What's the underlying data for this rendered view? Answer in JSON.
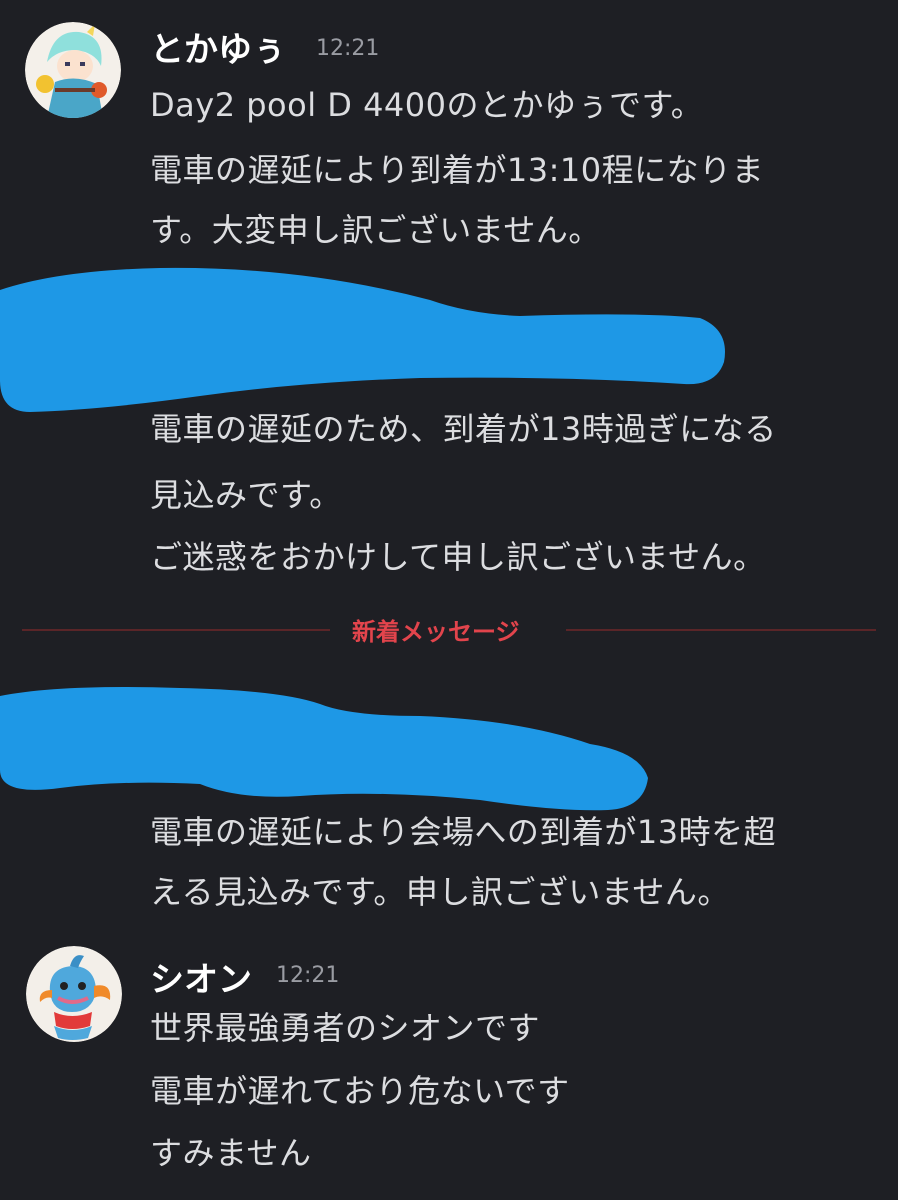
{
  "messages": [
    {
      "username": "とかゆぅ",
      "time": "12:21",
      "lines": [
        "Day2 pool D 4400のとかゆぅです。",
        "電車の遅延により到着が13:10程になりま",
        "す。大変申し訳ございません。"
      ]
    },
    {
      "lines": [
        "電車の遅延のため、到着が13時過ぎになる",
        "見込みです。",
        "ご迷惑をおかけして申し訳ございません。"
      ]
    },
    {
      "lines": [
        "電車の遅延により会場への到着が13時を超",
        "える見込みです。申し訳ございません。"
      ]
    },
    {
      "username": "シオン",
      "time": "12:21",
      "lines": [
        "世界最強勇者のシオンです",
        "電車が遅れており危ないです",
        "すみません"
      ]
    }
  ],
  "divider": {
    "label": "新着メッセージ"
  },
  "colors": {
    "background": "#1e1f24",
    "text": "#dcdde0",
    "new_messages": "#e2444c",
    "redaction": "#1e98e6"
  },
  "icons": {
    "avatar_1": "anime-character-avatar",
    "avatar_2": "mudkip-avatar"
  }
}
